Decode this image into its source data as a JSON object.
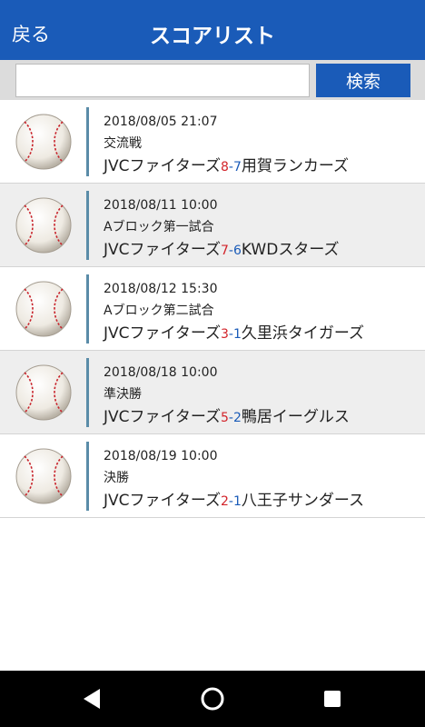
{
  "header": {
    "back_label": "戻る",
    "title": "スコアリスト"
  },
  "search": {
    "value": "",
    "placeholder": "",
    "button_label": "検索"
  },
  "games": [
    {
      "datetime": "2018/08/05 21:07",
      "round": "交流戦",
      "home": "JVCファイターズ",
      "home_score": "8",
      "away_score": "7",
      "away": "用賀ランカーズ"
    },
    {
      "datetime": "2018/08/11 10:00",
      "round": "Aブロック第一試合",
      "home": "JVCファイターズ",
      "home_score": "7",
      "away_score": "6",
      "away": "KWDスターズ"
    },
    {
      "datetime": "2018/08/12 15:30",
      "round": "Aブロック第二試合",
      "home": "JVCファイターズ",
      "home_score": "3",
      "away_score": "1",
      "away": "久里浜タイガーズ"
    },
    {
      "datetime": "2018/08/18 10:00",
      "round": "準決勝",
      "home": "JVCファイターズ",
      "home_score": "5",
      "away_score": "2",
      "away": "鴨居イーグルス"
    },
    {
      "datetime": "2018/08/19 10:00",
      "round": "決勝",
      "home": "JVCファイターズ",
      "home_score": "2",
      "away_score": "1",
      "away": "八王子サンダース"
    }
  ],
  "score_separator": "-",
  "icons": {
    "row_icon": "baseball-icon",
    "nav_back": "back-triangle-icon",
    "nav_home": "home-circle-icon",
    "nav_recents": "recents-square-icon"
  },
  "colors": {
    "header_bg": "#1a5bb8",
    "home_score": "#d2232a",
    "away_score": "#1a5bb8",
    "accent_bar": "#5a8ca8"
  }
}
